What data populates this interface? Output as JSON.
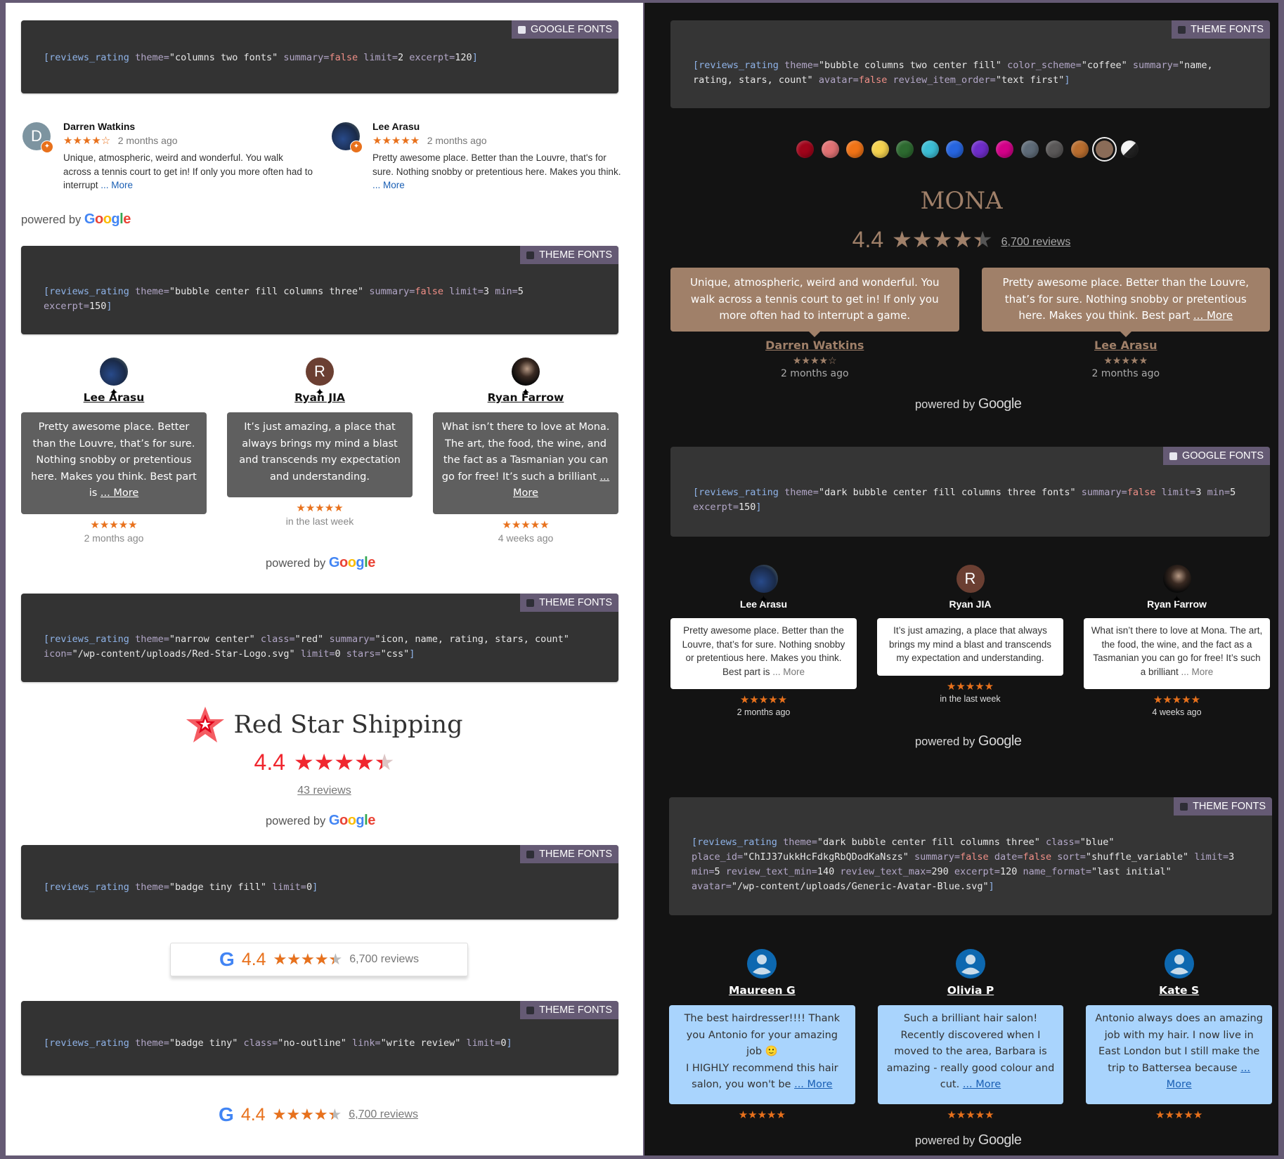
{
  "left": {
    "block1": {
      "font_tag": "GOOGLE FONTS",
      "code": {
        "tag": "reviews_rating",
        "parts": [
          [
            "a",
            "theme="
          ],
          [
            "s",
            "\"columns two fonts\" "
          ],
          [
            "a",
            "summary="
          ],
          [
            "f",
            "false "
          ],
          [
            "a",
            "limit="
          ],
          [
            "n",
            "2 "
          ],
          [
            "a",
            "excerpt="
          ],
          [
            "n",
            "120"
          ]
        ]
      },
      "reviews": [
        {
          "name": "Darren Watkins",
          "initial": "D",
          "stars": "★★★★☆",
          "rating": 4,
          "date": "2 months ago",
          "text": "Unique, atmospheric, weird and wonderful. You walk across a tennis court to get in! If only you more often had to interrupt",
          "more": "... More"
        },
        {
          "name": "Lee Arasu",
          "initial": "",
          "stars": "★★★★★",
          "rating": 5,
          "date": "2 months ago",
          "text": "Pretty awesome place. Better than the Louvre, that's for sure. Nothing snobby or pretentious here. Makes you think.",
          "more": "... More"
        }
      ],
      "powered_by": "powered by",
      "google": "Google"
    },
    "block2": {
      "font_tag": "THEME FONTS",
      "code": {
        "tag": "reviews_rating",
        "parts": [
          [
            "a",
            "theme="
          ],
          [
            "s",
            "\"bubble center fill columns three\" "
          ],
          [
            "a",
            "summary="
          ],
          [
            "f",
            "false "
          ],
          [
            "a",
            "limit="
          ],
          [
            "n",
            "3 "
          ],
          [
            "a",
            "min="
          ],
          [
            "n",
            "5 "
          ],
          [
            "a",
            "excerpt="
          ],
          [
            "n",
            "150"
          ]
        ]
      },
      "reviews": [
        {
          "name": "Lee Arasu",
          "initial": "",
          "text": "Pretty awesome place. Better than the Louvre, that’s for sure. Nothing snobby or pretentious here. Makes you think. Best part is",
          "more": "... More",
          "stars": "★★★★★",
          "rating": 5,
          "date": "2 months ago"
        },
        {
          "name": "Ryan JIA",
          "initial": "R",
          "text": "It’s just amazing, a place that always brings my mind a blast and transcends my expectation and understanding.",
          "more": "",
          "stars": "★★★★★",
          "rating": 5,
          "date": "in the last week"
        },
        {
          "name": "Ryan Farrow",
          "initial": "",
          "text": "What isn’t there to love at Mona. The art, the food, the wine, and the fact as a Tasmanian you can go for free! It’s such a brilliant",
          "more": "... More",
          "stars": "★★★★★",
          "rating": 5,
          "date": "4 weeks ago"
        }
      ],
      "powered_by": "powered by",
      "google": "Google"
    },
    "block3": {
      "font_tag": "THEME FONTS",
      "code": {
        "tag": "reviews_rating",
        "parts": [
          [
            "a",
            "theme="
          ],
          [
            "s",
            "\"narrow center\" "
          ],
          [
            "a",
            "class="
          ],
          [
            "s",
            "\"red\" "
          ],
          [
            "a",
            "summary="
          ],
          [
            "s",
            "\"icon, name, rating, stars, count\" "
          ],
          [
            "a",
            "icon="
          ],
          [
            "s",
            "\"/wp-content/uploads/Red-Star-Logo.svg\" "
          ],
          [
            "a",
            "limit="
          ],
          [
            "n",
            "0 "
          ],
          [
            "a",
            "stars="
          ],
          [
            "s",
            "\"css\""
          ]
        ]
      },
      "business_name": "Red Star Shipping",
      "rating": "4.4",
      "rating_value": 4.4,
      "review_count": "43 reviews",
      "powered_by": "powered by",
      "google": "Google"
    },
    "block4": {
      "font_tag": "THEME FONTS",
      "code": {
        "tag": "reviews_rating",
        "parts": [
          [
            "a",
            "theme="
          ],
          [
            "s",
            "\"badge tiny fill\" "
          ],
          [
            "a",
            "limit="
          ],
          [
            "n",
            "0"
          ]
        ]
      },
      "rating": "4.4",
      "rating_value": 4.4,
      "review_count": "6,700 reviews"
    },
    "block5": {
      "font_tag": "THEME FONTS",
      "code": {
        "tag": "reviews_rating",
        "parts": [
          [
            "a",
            "theme="
          ],
          [
            "s",
            "\"badge tiny\" "
          ],
          [
            "a",
            "class="
          ],
          [
            "s",
            "\"no-outline\" "
          ],
          [
            "a",
            "link="
          ],
          [
            "s",
            "\"write review\" "
          ],
          [
            "a",
            "limit="
          ],
          [
            "n",
            "0"
          ]
        ]
      },
      "rating": "4.4",
      "rating_value": 4.4,
      "review_count": "6,700 reviews"
    }
  },
  "right": {
    "block1": {
      "font_tag": "THEME FONTS",
      "code": {
        "tag": "reviews_rating",
        "parts": [
          [
            "a",
            "theme="
          ],
          [
            "s",
            "\"bubble columns two center fill\" "
          ],
          [
            "a",
            "color_scheme="
          ],
          [
            "s",
            "\"coffee\" "
          ],
          [
            "a",
            "summary="
          ],
          [
            "s",
            "\"name, rating, stars, count\" "
          ],
          [
            "a",
            "avatar="
          ],
          [
            "f",
            "false "
          ],
          [
            "a",
            "review_item_order="
          ],
          [
            "s",
            "\"text first\""
          ]
        ]
      },
      "color_schemes": [
        {
          "name": "red",
          "color": "#a0041a"
        },
        {
          "name": "pink",
          "color": "#e07173"
        },
        {
          "name": "orange",
          "color": "#f07316"
        },
        {
          "name": "yellow",
          "color": "#f5d24e"
        },
        {
          "name": "green",
          "color": "#2d6a30"
        },
        {
          "name": "cyan",
          "color": "#3bbdd4"
        },
        {
          "name": "blue",
          "color": "#2665e0"
        },
        {
          "name": "purple",
          "color": "#6e2cc9"
        },
        {
          "name": "magenta",
          "color": "#d30088"
        },
        {
          "name": "slate",
          "color": "#5e6b78"
        },
        {
          "name": "grey",
          "color": "#5a5858"
        },
        {
          "name": "bronze",
          "color": "#b96d2e"
        },
        {
          "name": "coffee",
          "color": "#8a6c58",
          "selected": true
        },
        {
          "name": "black-white",
          "color": "split"
        }
      ],
      "business_name": "MONA",
      "rating": "4.4",
      "rating_value": 4.4,
      "review_count": "6,700 reviews",
      "reviews": [
        {
          "name": "Darren Watkins",
          "text": "Unique, atmospheric, weird and wonderful. You walk across a tennis court to get in! If only you more often had to interrupt a game.",
          "more": "",
          "stars": "★★★★☆",
          "rating": 4,
          "date": "2 months ago"
        },
        {
          "name": "Lee Arasu",
          "text": "Pretty awesome place. Better than the Louvre, that’s for sure. Nothing snobby or pretentious here. Makes you think. Best part",
          "more": "... More",
          "stars": "★★★★★",
          "rating": 5,
          "date": "2 months ago"
        }
      ],
      "powered_by": "powered by",
      "google": "Google"
    },
    "block2": {
      "font_tag": "GOOGLE FONTS",
      "code": {
        "tag": "reviews_rating",
        "parts": [
          [
            "a",
            "theme="
          ],
          [
            "s",
            "\"dark bubble center fill columns three fonts\" "
          ],
          [
            "a",
            "summary="
          ],
          [
            "f",
            "false "
          ],
          [
            "a",
            "limit="
          ],
          [
            "n",
            "3 "
          ],
          [
            "a",
            "min="
          ],
          [
            "n",
            "5 "
          ],
          [
            "a",
            "excerpt="
          ],
          [
            "n",
            "150"
          ]
        ]
      },
      "reviews": [
        {
          "name": "Lee Arasu",
          "initial": "",
          "text": "Pretty awesome place. Better than the Louvre, that’s for sure. Nothing snobby or pretentious here. Makes you think. Best part is",
          "more": "... More",
          "stars": "★★★★★",
          "rating": 5,
          "date": "2 months ago"
        },
        {
          "name": "Ryan JIA",
          "initial": "R",
          "text": "It’s just amazing, a place that always brings my mind a blast and transcends my expectation and understanding.",
          "more": "",
          "stars": "★★★★★",
          "rating": 5,
          "date": "in the last week"
        },
        {
          "name": "Ryan Farrow",
          "initial": "",
          "text": "What isn’t there to love at Mona. The art, the food, the wine, and the fact as a Tasmanian you can go for free! It’s such a brilliant",
          "more": "... More",
          "stars": "★★★★★",
          "rating": 5,
          "date": "4 weeks ago"
        }
      ],
      "powered_by": "powered by",
      "google": "Google"
    },
    "block3": {
      "font_tag": "THEME FONTS",
      "code": {
        "tag": "reviews_rating",
        "parts": [
          [
            "a",
            "theme="
          ],
          [
            "s",
            "\"dark bubble center fill columns three\" "
          ],
          [
            "a",
            "class="
          ],
          [
            "s",
            "\"blue\" "
          ],
          [
            "a",
            "place_id="
          ],
          [
            "s",
            "\"ChIJ37ukkHcFdkgRbQDodKaNszs\" "
          ],
          [
            "a",
            "summary="
          ],
          [
            "f",
            "false "
          ],
          [
            "a",
            "date="
          ],
          [
            "f",
            "false "
          ],
          [
            "a",
            "sort="
          ],
          [
            "s",
            "\"shuffle_variable\" "
          ],
          [
            "a",
            "limit="
          ],
          [
            "n",
            "3 "
          ],
          [
            "a",
            "min="
          ],
          [
            "n",
            "5 "
          ],
          [
            "a",
            "review_text_min="
          ],
          [
            "n",
            "140 "
          ],
          [
            "a",
            "review_text_max="
          ],
          [
            "n",
            "290 "
          ],
          [
            "a",
            "excerpt="
          ],
          [
            "n",
            "120 "
          ],
          [
            "a",
            "name_format="
          ],
          [
            "s",
            "\"last initial\" "
          ],
          [
            "a",
            "avatar="
          ],
          [
            "s",
            "\"/wp-content/uploads/Generic-Avatar-Blue.svg\""
          ]
        ]
      },
      "reviews": [
        {
          "name": "Maureen G",
          "text": "The best hairdresser!!!! Thank you Antonio for your amazing job 🙂",
          "text2": "I HIGHLY recommend this hair salon, you won't be",
          "more": "... More",
          "stars": "★★★★★",
          "rating": 5
        },
        {
          "name": "Olivia P",
          "text": "Such a brilliant hair salon! Recently discovered when I moved to the area, Barbara is amazing - really good colour and cut.",
          "text2": "",
          "more": "... More",
          "stars": "★★★★★",
          "rating": 5
        },
        {
          "name": "Kate S",
          "text": "Antonio always does an amazing job with my hair. I now live in East London but I still make the trip to Battersea because",
          "text2": "",
          "more": "... More",
          "stars": "★★★★★",
          "rating": 5
        }
      ],
      "powered_by": "powered by",
      "google": "Google"
    }
  },
  "colors": {
    "frame": "#655a74",
    "code_bg": "#333333",
    "star_orange": "#e8711c",
    "star_red": "#f0262e",
    "coffee": "#a08069",
    "blue_bubble": "#a9d4fd",
    "link_blue": "#1a5fb4"
  }
}
